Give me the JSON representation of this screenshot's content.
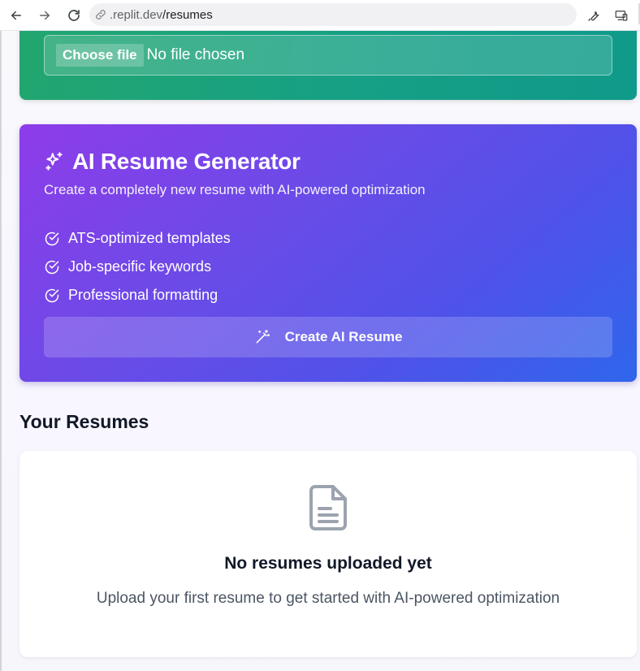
{
  "browser": {
    "url_host": ".replit.dev",
    "url_path": "/resumes"
  },
  "upload": {
    "choose_label": "Choose file",
    "status": "No file chosen"
  },
  "ai_generator": {
    "title": "AI Resume Generator",
    "subtitle": "Create a completely new resume with AI-powered optimization",
    "features": [
      "ATS-optimized templates",
      "Job-specific keywords",
      "Professional formatting"
    ],
    "button_label": "Create AI Resume"
  },
  "resumes": {
    "heading": "Your Resumes",
    "empty_title": "No resumes uploaded yet",
    "empty_description": "Upload your first resume to get started with AI-powered optimization"
  },
  "colors": {
    "upload_gradient_start": "#22a66f",
    "upload_gradient_end": "#0f9a8a",
    "ai_gradient_start": "#8e3ce9",
    "ai_gradient_end": "#2f66ec",
    "doc_icon": "#9ca3af"
  }
}
